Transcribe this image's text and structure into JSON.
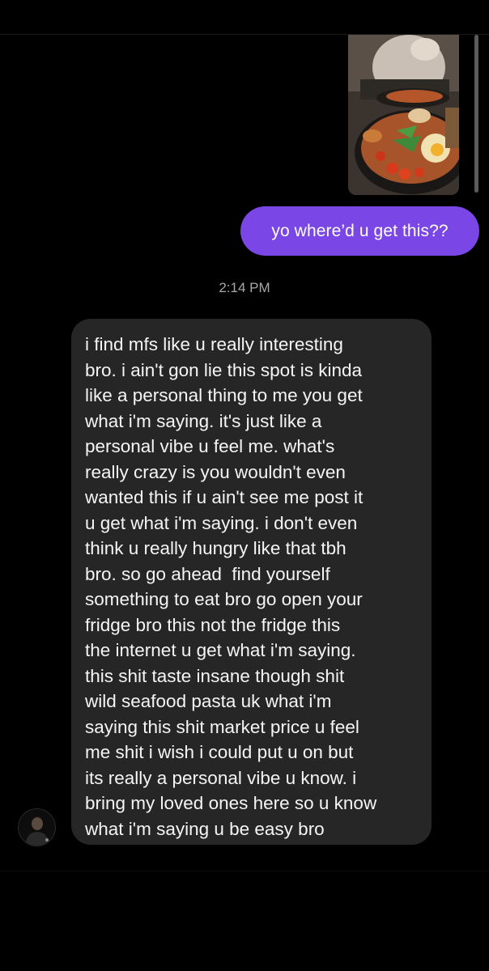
{
  "conversation": {
    "sent_photo": {
      "icon": "food-photo",
      "description_icon": "photo-thumbnail-icon"
    },
    "sent_message": "yo where’d u get this??",
    "timestamp": "2:14 PM",
    "received_message": {
      "lines": [
        "i find mfs like u really interesting",
        "bro. i ain't gon lie this spot is kinda",
        "like a personal thing to me you get",
        "what i'm saying. it's just like a",
        "personal vibe u feel me. what's",
        "really crazy is you wouldn't even",
        "wanted this if u ain't see me post it",
        "u get what i'm saying. i don't even",
        "think u really hungry like that tbh",
        "bro. so go ahead  find yourself",
        "something to eat bro go open your",
        "fridge bro this not the fridge this",
        "the internet u get what i'm saying.",
        "this shit taste insane though shit",
        "wild seafood pasta uk what i'm",
        "saying this shit market price u feel",
        "me shit i wish i could put u on but",
        "its really a personal vibe u know. i",
        "bring my loved ones here so u know",
        "what i'm saying u be easy bro"
      ]
    },
    "sender_avatar": {
      "icon": "avatar-icon"
    }
  },
  "colors": {
    "background": "#000000",
    "sent_bubble": "#7a46e5",
    "received_bubble": "#262626",
    "timestamp_text": "#a8a8a8"
  }
}
